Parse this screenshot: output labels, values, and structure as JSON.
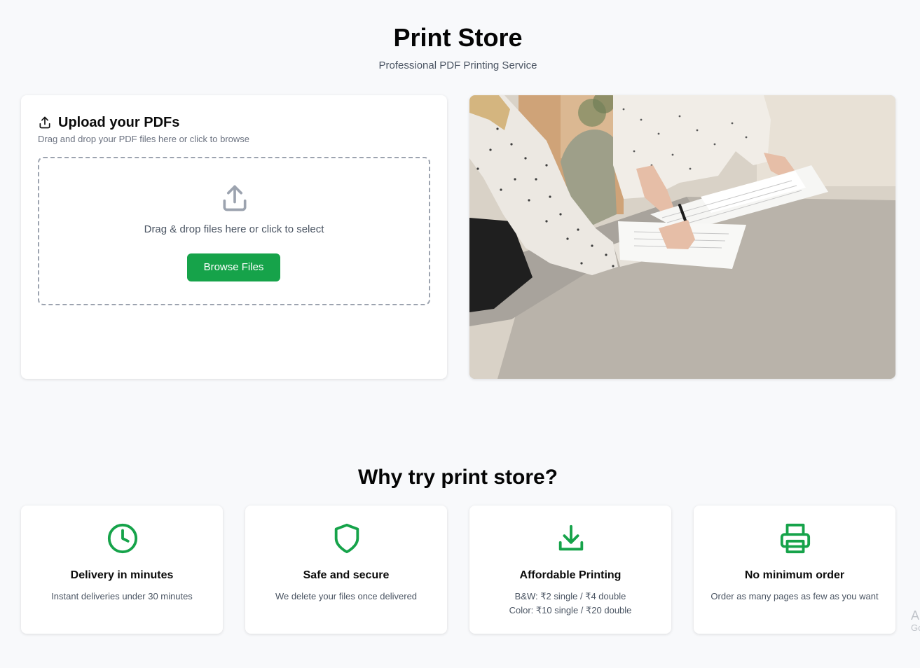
{
  "header": {
    "title": "Print Store",
    "subtitle": "Professional PDF Printing Service"
  },
  "upload": {
    "heading": "Upload your PDFs",
    "description": "Drag and drop your PDF files here or click to browse",
    "drop_text": "Drag & drop files here or click to select",
    "browse_label": "Browse Files",
    "icon": "upload-icon"
  },
  "hero_image": {
    "alt": "Two people reviewing printed documents at a table"
  },
  "why": {
    "title": "Why try print store?",
    "features": [
      {
        "icon": "clock-icon",
        "title": "Delivery in minutes",
        "description": "Instant deliveries under 30 minutes"
      },
      {
        "icon": "shield-icon",
        "title": "Safe and secure",
        "description": "We delete your files once delivered"
      },
      {
        "icon": "download-icon",
        "title": "Affordable Printing",
        "description_lines": [
          "B&W: ₹2 single / ₹4 double",
          "Color: ₹10 single / ₹20 double"
        ]
      },
      {
        "icon": "printer-icon",
        "title": "No minimum order",
        "description": "Order as many pages as few as you want"
      }
    ]
  },
  "edge_watermark": {
    "line1": "A",
    "line2": "Go"
  },
  "colors": {
    "accent": "#16a34a",
    "page_background": "#f8f9fb",
    "card_background": "#ffffff"
  }
}
